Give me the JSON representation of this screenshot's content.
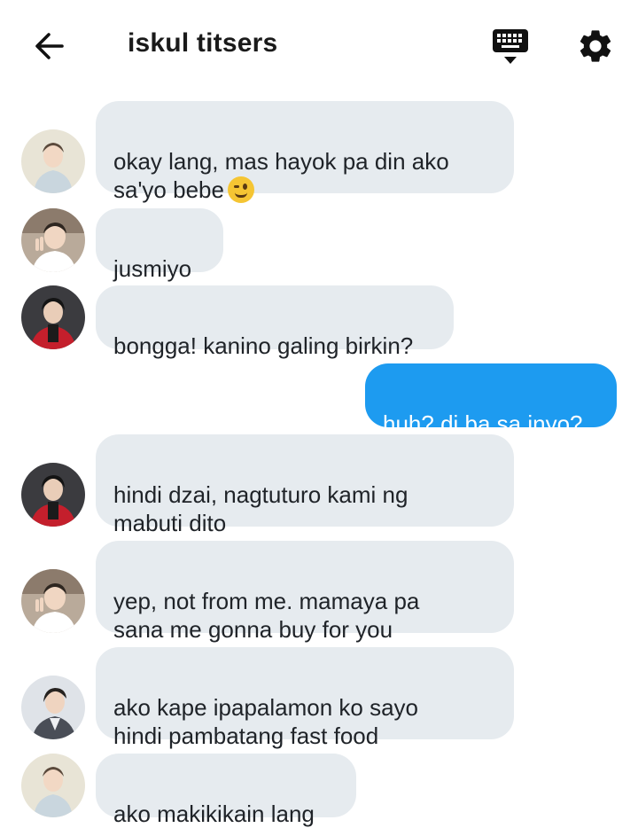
{
  "header": {
    "title": "iskul titsers",
    "back_icon": "arrow-left-icon",
    "keyboard_icon": "keyboard-icon",
    "settings_icon": "gear-icon"
  },
  "colors": {
    "incoming_bubble": "#e6ebef",
    "outgoing_bubble": "#1d9bf0",
    "outgoing_text": "#ffffff"
  },
  "messages": [
    {
      "sender_avatar": "avatar-light-suit",
      "text": "okay lang, mas hayok pa din ako\nsa'yo bebe",
      "emoji": "winking-face-icon",
      "outgoing": false
    },
    {
      "sender_avatar": "avatar-peace-sign",
      "text": "jusmiyo",
      "outgoing": false
    },
    {
      "sender_avatar": "avatar-red-jacket",
      "text": "bongga! kanino galing birkin?",
      "outgoing": false
    },
    {
      "text": "huh? di ba sa inyo?",
      "outgoing": true
    },
    {
      "sender_avatar": "avatar-red-jacket",
      "text": "hindi dzai, nagtuturo kami ng\nmabuti dito",
      "outgoing": false
    },
    {
      "sender_avatar": "avatar-peace-sign",
      "text": "yep, not from me. mamaya pa\nsana me gonna buy for you",
      "outgoing": false
    },
    {
      "sender_avatar": "avatar-dark-suit",
      "text": "ako kape ipapalamon ko sayo\nhindi pambatang fast food",
      "outgoing": false
    },
    {
      "sender_avatar": "avatar-light-suit",
      "text": "ako makikikain lang",
      "outgoing": false
    }
  ]
}
